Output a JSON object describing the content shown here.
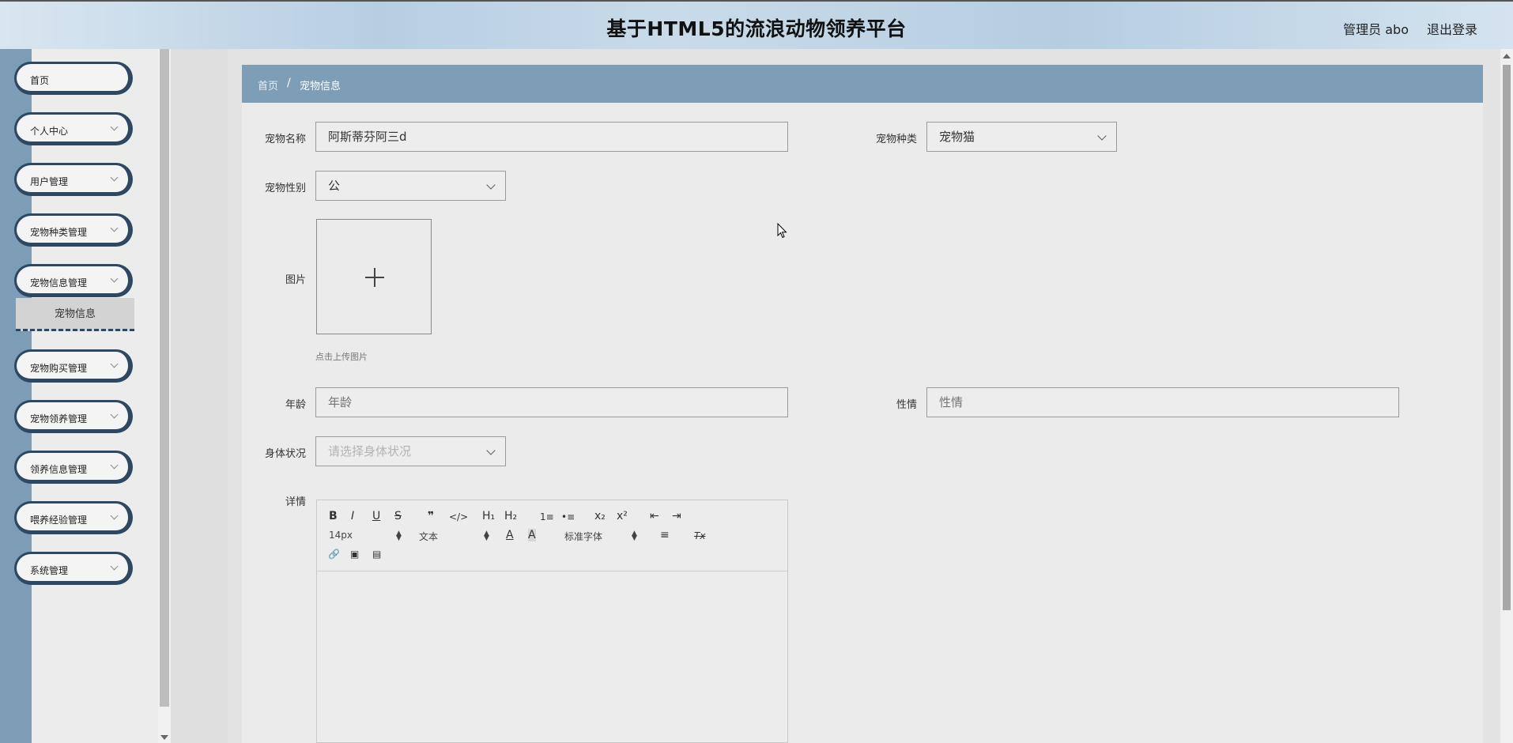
{
  "header": {
    "title": "基于HTML5的流浪动物领养平台",
    "user": "管理员 abo",
    "logout": "退出登录"
  },
  "sidebar": {
    "items": [
      {
        "label": "首页"
      },
      {
        "label": "个人中心"
      },
      {
        "label": "用户管理"
      },
      {
        "label": "宠物种类管理"
      },
      {
        "label": "宠物信息管理"
      },
      {
        "label": "宠物购买管理"
      },
      {
        "label": "宠物领养管理"
      },
      {
        "label": "领养信息管理"
      },
      {
        "label": "喂养经验管理"
      },
      {
        "label": "系统管理"
      }
    ],
    "active_sub": "宠物信息"
  },
  "breadcrumb": {
    "home": "首页",
    "separator": "/",
    "current": "宠物信息"
  },
  "form": {
    "pet_name": {
      "label": "宠物名称",
      "value": "阿斯蒂芬阿三d"
    },
    "pet_type": {
      "label": "宠物种类",
      "value": "宠物猫"
    },
    "pet_gender": {
      "label": "宠物性别",
      "value": "公"
    },
    "image": {
      "label": "图片",
      "hint": "点击上传图片"
    },
    "age": {
      "label": "年龄",
      "placeholder": "年龄"
    },
    "temperament": {
      "label": "性情",
      "placeholder": "性情"
    },
    "health": {
      "label": "身体状况",
      "placeholder": "请选择身体状况"
    },
    "details": {
      "label": "详情"
    }
  },
  "editor": {
    "font_size": "14px",
    "text_style": "文本",
    "font_family": "标准字体",
    "buttons": {
      "bold": "B",
      "italic": "I",
      "underline": "U",
      "strike": "S",
      "quote": "❞",
      "code": "</>",
      "h1": "H₁",
      "h2": "H₂",
      "ordered": "1≡",
      "bullet": "•≡",
      "sub": "x₂",
      "sup": "x²",
      "outdent": "⇤",
      "indent": "⇥",
      "color": "A",
      "background": "A",
      "align": "≡",
      "clean": "Tx",
      "link": "🔗",
      "image": "▣",
      "video": "▤"
    }
  },
  "colors": {
    "sidebar_accent": "#2c4863",
    "breadcrumb_bg": "#7d9eb6",
    "sidebar_edge": "#7d9db6"
  }
}
